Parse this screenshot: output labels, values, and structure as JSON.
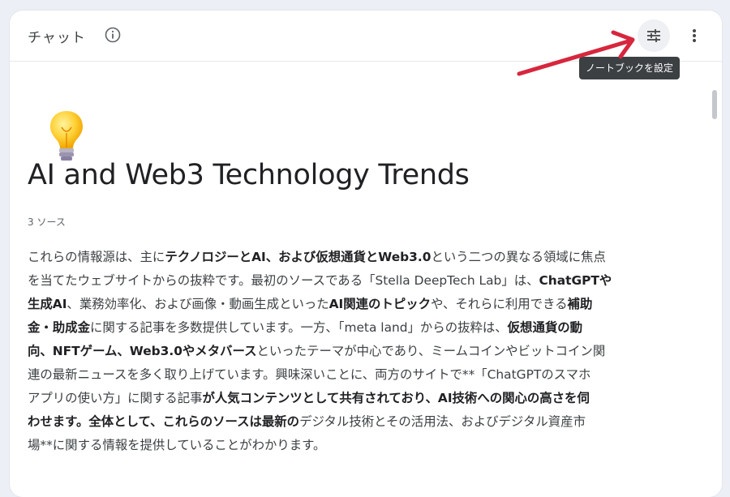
{
  "header": {
    "title": "チャット",
    "info_icon": "info-icon",
    "tune_icon": "tune-icon",
    "more_icon": "more-vert-icon"
  },
  "tooltip": {
    "text": "ノートブックを設定"
  },
  "annotation": {
    "arrow_color": "#d7263d"
  },
  "notebook": {
    "emoji": "lightbulb",
    "title": "AI and Web3 Technology Trends",
    "source_count": "3 ソース",
    "summary_lines": [
      [
        {
          "t": "これらの情報源は、主に"
        },
        {
          "t": "テクノロジーとAI、および仮想通貨とWeb3.0",
          "b": true
        },
        {
          "t": "という二つの異なる領域に焦点"
        }
      ],
      [
        {
          "t": "を当てたウェブサイトからの抜粋です。最初のソースである「Stella DeepTech Lab」は、"
        },
        {
          "t": "ChatGPTや",
          "b": true
        }
      ],
      [
        {
          "t": "生成AI",
          "b": true
        },
        {
          "t": "、業務効率化、および画像・動画生成といった"
        },
        {
          "t": "AI関連のトピック",
          "b": true
        },
        {
          "t": "や、それらに利用できる"
        },
        {
          "t": "補助",
          "b": true
        }
      ],
      [
        {
          "t": "金・助成金",
          "b": true
        },
        {
          "t": "に関する記事を多数提供しています。一方、「meta land」からの抜粋は、"
        },
        {
          "t": "仮想通貨の動",
          "b": true
        }
      ],
      [
        {
          "t": "向、NFTゲーム、Web3.0やメタバース",
          "b": true
        },
        {
          "t": "といったテーマが中心であり、ミームコインやビットコイン関"
        }
      ],
      [
        {
          "t": "連の最新ニュースを多く取り上げています。興味深いことに、両方のサイトで**「ChatGPTのスマホ"
        }
      ],
      [
        {
          "t": "アプリの使い方」に関する記事"
        },
        {
          "t": "が人気コンテンツとして共有されており、AI技術への関心の高さを伺",
          "b": true
        }
      ],
      [
        {
          "t": "わせます。全体として、これらのソースは最新の",
          "b": true
        },
        {
          "t": "デジタル技術とその活用法、およびデジタル資産市"
        }
      ],
      [
        {
          "t": "場**に関する情報を提供していることがわかります。"
        }
      ]
    ]
  }
}
